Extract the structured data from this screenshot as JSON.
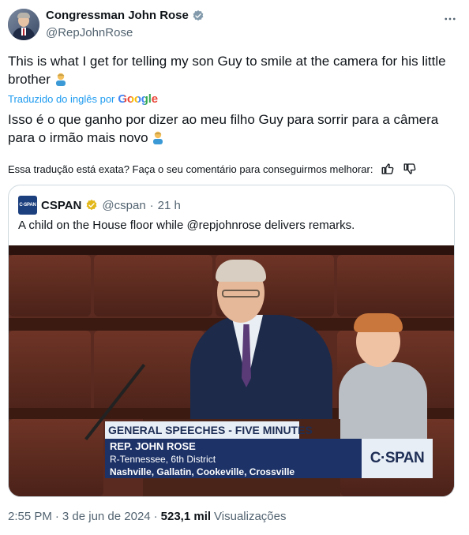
{
  "author": {
    "display_name": "Congressman John Rose",
    "handle": "@RepJohnRose"
  },
  "tweet": {
    "text": "This is what I get for telling my son Guy to smile at the camera for his little brother",
    "translated_by_label": "Traduzido do inglês por",
    "translated_by_brand": "Google",
    "translation": "Isso é o que ganho por dizer ao meu filho Guy para sorrir para a câmera para o irmão mais novo",
    "feedback_prompt": "Essa tradução está exata? Faça o seu comentário para conseguirmos melhorar:"
  },
  "quote": {
    "logo_text": "C-SPAN",
    "name": "CSPAN",
    "handle": "@cspan",
    "age": "21 h",
    "text": "A child on the House floor while @repjohnrose delivers remarks.",
    "video": {
      "banner_title": "GENERAL SPEECHES - FIVE MINUTES",
      "name": "REP. JOHN ROSE",
      "district": "R-Tennessee, 6th District",
      "towns": "Nashville, Gallatin, Cookeville, Crossville",
      "network": "C·SPAN"
    }
  },
  "footer": {
    "time": "2:55 PM",
    "date": "3 de jun de 2024",
    "views_count": "523,1 mil",
    "views_label": "Visualizações"
  },
  "colors": {
    "accent": "#1d9bf0",
    "secondary_text": "#536471",
    "border": "#cfd9de",
    "gold_badge": "#e2b719"
  }
}
